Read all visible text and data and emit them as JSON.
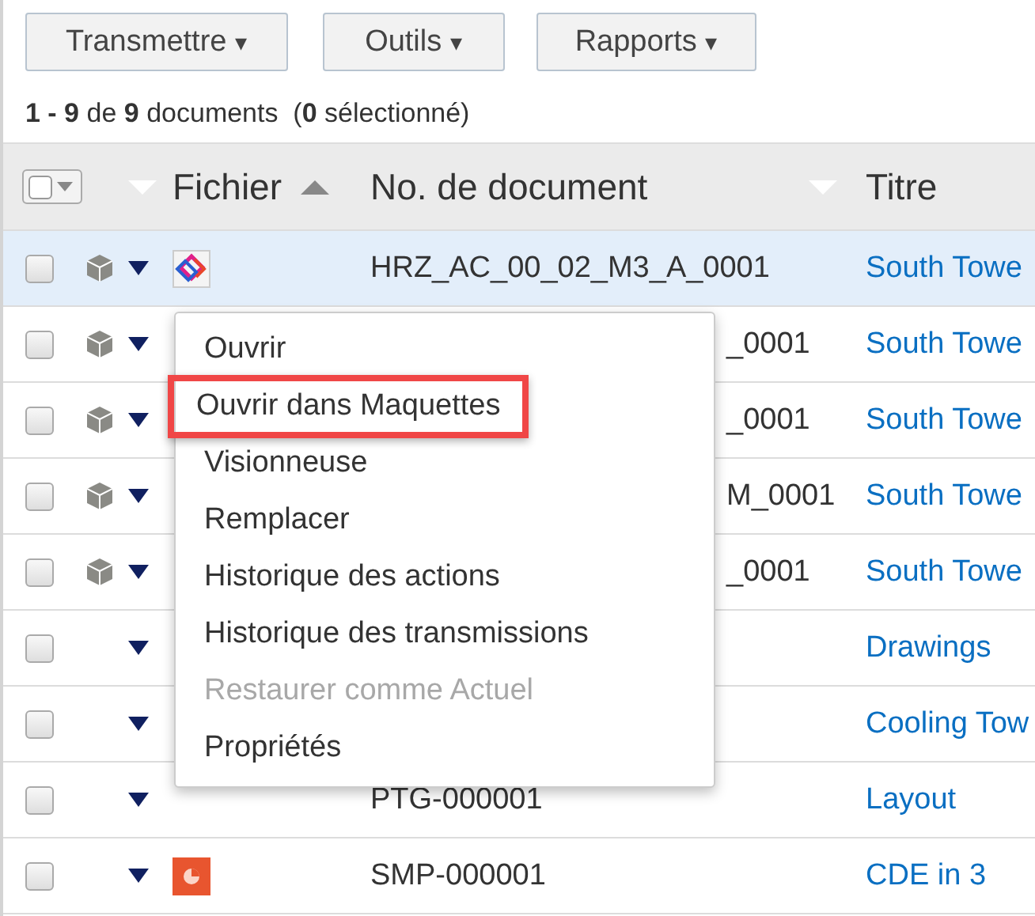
{
  "toolbar": [
    {
      "label": "Transmettre",
      "caret": "▾"
    },
    {
      "label": "Outils",
      "caret": "▾"
    },
    {
      "label": "Rapports",
      "caret": "▾"
    }
  ],
  "summary": "**1 - 9** de **9** documents  (**0** sélectionné)",
  "columns": [
    {
      "label": "Fichier",
      "sorted": true
    },
    {
      "label": "No. de document",
      "sorted": false
    },
    {
      "label": "Titre"
    }
  ],
  "rows": [
    {
      "selected": true,
      "cube": true,
      "file": {
        "kind": "model"
      },
      "doc_number": "HRZ_AC_00_02_M3_A_0001",
      "covered": false,
      "title": "South Towe"
    },
    {
      "selected": false,
      "cube": true,
      "doc_number": "_0001",
      "covered": true,
      "title": "South Towe"
    },
    {
      "selected": false,
      "cube": true,
      "doc_number": "_0001",
      "covered": true,
      "title": "South Towe"
    },
    {
      "selected": false,
      "cube": true,
      "doc_number": "M_0001",
      "covered": true,
      "title": "South Towe"
    },
    {
      "selected": false,
      "cube": true,
      "doc_number": "_0001",
      "covered": true,
      "title": "South Towe"
    },
    {
      "selected": false,
      "cube": false,
      "title": "Drawings"
    },
    {
      "selected": false,
      "cube": false,
      "title": "Cooling Tow"
    },
    {
      "selected": false,
      "cube": false,
      "doc_number": "PTG-000001",
      "covered": false,
      "title": "Layout"
    },
    {
      "selected": false,
      "cube": false,
      "file": {
        "kind": "presentation"
      },
      "doc_number": "SMP-000001",
      "covered": false,
      "title": "CDE in 3"
    }
  ],
  "context_menu": [
    {
      "label": "Ouvrir",
      "disabled": false,
      "highlighted": false
    },
    {
      "label": "Ouvrir dans Maquettes",
      "disabled": false,
      "highlighted": true
    },
    {
      "label": "Visionneuse",
      "disabled": false,
      "highlighted": false
    },
    {
      "label": "Remplacer",
      "disabled": false,
      "highlighted": false
    },
    {
      "label": "Historique des actions",
      "disabled": false,
      "highlighted": false
    },
    {
      "label": "Historique des transmissions",
      "disabled": false,
      "highlighted": false
    },
    {
      "label": "Restaurer comme Actuel",
      "disabled": true,
      "highlighted": false
    },
    {
      "label": "Propriétés",
      "disabled": false,
      "highlighted": false
    }
  ]
}
